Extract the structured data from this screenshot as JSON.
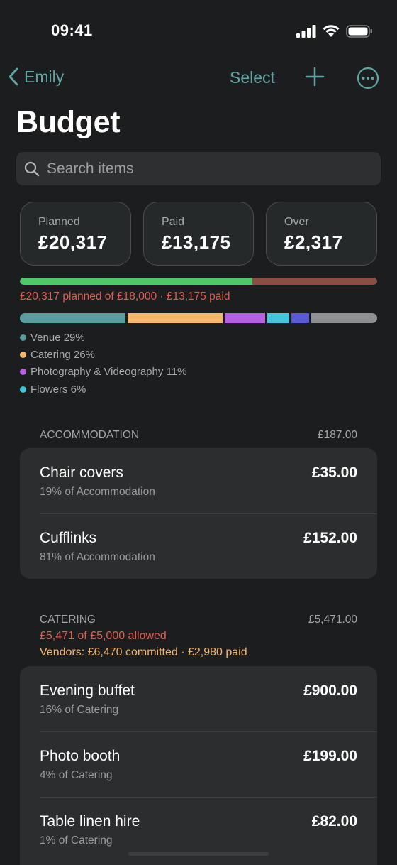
{
  "status_bar": {
    "time": "09:41"
  },
  "nav": {
    "back_label": "Emily",
    "select_label": "Select"
  },
  "title": "Budget",
  "search": {
    "placeholder": "Search items"
  },
  "stats": [
    {
      "label": "Planned",
      "value": "£20,317"
    },
    {
      "label": "Paid",
      "value": "£13,175"
    },
    {
      "label": "Over",
      "value": "£2,317"
    }
  ],
  "progress": {
    "fraction": 0.65,
    "text": "£20,317 planned of £18,000 · £13,175 paid",
    "fill_color": "#4fc86a",
    "track_color": "#8a4e45"
  },
  "category_bar": [
    {
      "color": "#5a9ea0",
      "share": 29
    },
    {
      "color": "#f5b56b",
      "share": 26
    },
    {
      "color": "#b661e3",
      "share": 11
    },
    {
      "color": "#43c6db",
      "share": 6
    },
    {
      "color": "#5a5ad6",
      "share": 5
    },
    {
      "color": "#8e9193",
      "share": 18
    }
  ],
  "legend": [
    {
      "label": "Venue 29%",
      "color": "#5a9ea0"
    },
    {
      "label": "Catering 26%",
      "color": "#f5b56b"
    },
    {
      "label": "Photography & Videography 11%",
      "color": "#b661e3"
    },
    {
      "label": "Flowers 6%",
      "color": "#43c6db"
    }
  ],
  "accommodation": {
    "title": "ACCOMMODATION",
    "total": "£187.00",
    "items": [
      {
        "name": "Chair covers",
        "sub": "19% of Accommodation",
        "amount": "£35.00"
      },
      {
        "name": "Cufflinks",
        "sub": "81% of Accommodation",
        "amount": "£152.00"
      }
    ]
  },
  "catering": {
    "title": "CATERING",
    "total": "£5,471.00",
    "warning": "£5,471 of £5,000 allowed",
    "vendors": "Vendors: £6,470 committed · £2,980 paid",
    "items": [
      {
        "name": "Evening buffet",
        "sub": "16% of Catering",
        "amount": "£900.00"
      },
      {
        "name": "Photo booth",
        "sub": "4% of Catering",
        "amount": "£199.00"
      },
      {
        "name": "Table linen hire",
        "sub": "1% of Catering",
        "amount": "£82.00"
      }
    ]
  },
  "colors": {
    "accent": "#5fa3a2",
    "over": "#e65b4f",
    "vendor": "#f5b56b"
  }
}
